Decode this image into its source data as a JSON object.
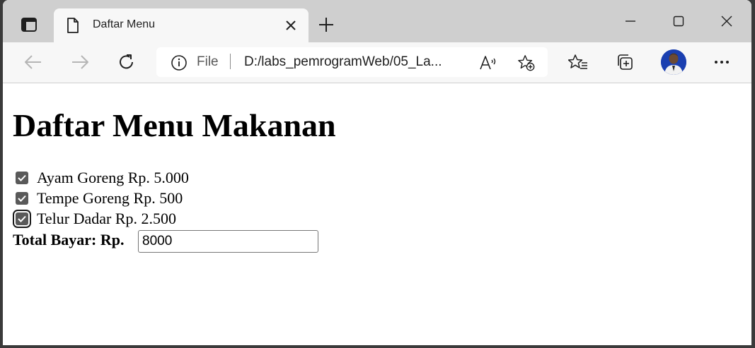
{
  "browser": {
    "tab": {
      "title": "Daftar Menu"
    },
    "address": {
      "scheme_label": "File",
      "url": "D:/labs_pemrogramWeb/05_La..."
    }
  },
  "page": {
    "title": "Daftar Menu Makanan",
    "menu_items": [
      {
        "label": "Ayam Goreng Rp. 5.000",
        "checked": true
      },
      {
        "label": "Tempe Goreng Rp. 500",
        "checked": true
      },
      {
        "label": "Telur Dadar Rp. 2.500",
        "checked": true
      }
    ],
    "total": {
      "label": "Total Bayar: Rp.",
      "value": "8000"
    }
  },
  "icons": [
    "tab-actions-icon",
    "page-icon",
    "close-icon",
    "plus-icon",
    "minimize-icon",
    "maximize-icon",
    "back-icon",
    "forward-icon",
    "refresh-icon",
    "info-icon",
    "read-aloud-icon",
    "add-favorite-icon",
    "favorites-icon",
    "collections-icon",
    "more-icon"
  ],
  "colors": {
    "titlebar": "#cfcfcf",
    "toolbar": "#f7f7f7",
    "checkbox": "#595959"
  }
}
